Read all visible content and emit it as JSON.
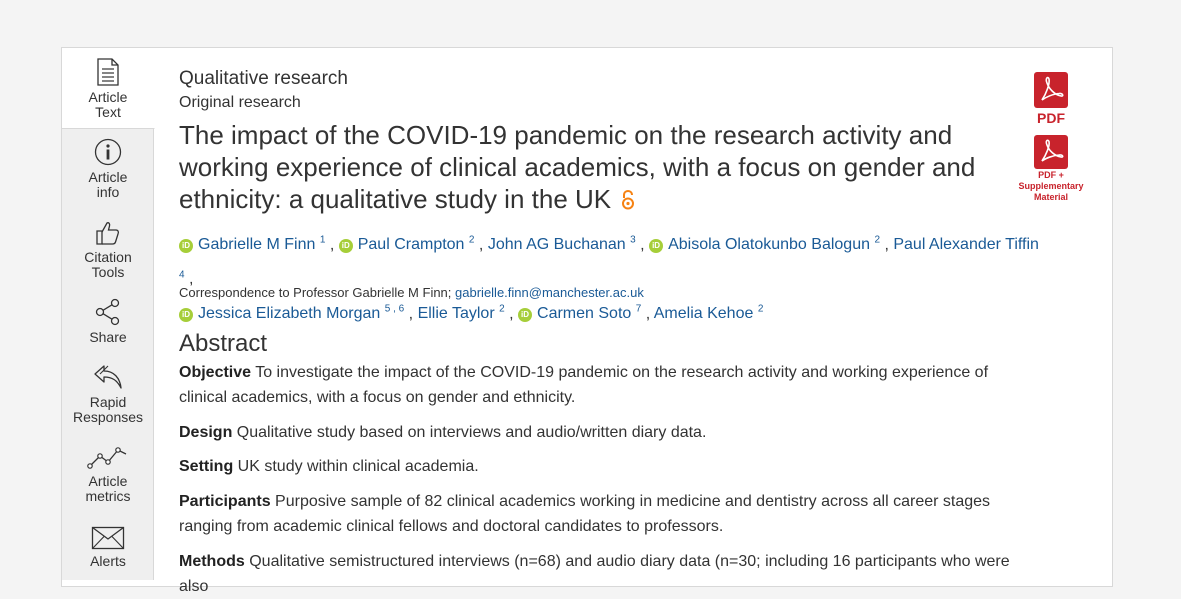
{
  "sidebar": {
    "items": [
      {
        "line1": "Article",
        "line2": "Text"
      },
      {
        "line1": "Article",
        "line2": "info"
      },
      {
        "line1": "Citation",
        "line2": "Tools"
      },
      {
        "line1": "Share",
        "line2": ""
      },
      {
        "line1": "Rapid",
        "line2": "Responses"
      },
      {
        "line1": "Article",
        "line2": "metrics"
      },
      {
        "line1": "Alerts",
        "line2": ""
      }
    ]
  },
  "article": {
    "section": "Qualitative research",
    "subsection": "Original research",
    "title": "The impact of the COVID-19 pandemic on the research activity and working experience of clinical academics, with a focus on gender and ethnicity: a qualitative study in the UK",
    "authors": [
      {
        "name": "Gabrielle M Finn",
        "aff": "1",
        "orcid": true
      },
      {
        "name": "Paul Crampton",
        "aff": "2",
        "orcid": true
      },
      {
        "name": "John AG Buchanan",
        "aff": "3",
        "orcid": false
      },
      {
        "name": "Abisola Olatokunbo Balogun",
        "aff": "2",
        "orcid": true
      },
      {
        "name": "Paul Alexander Tiffin",
        "aff": "4",
        "orcid": false
      },
      {
        "name": "Jessica Elizabeth Morgan",
        "aff": "5 , 6",
        "orcid": true
      },
      {
        "name": "Ellie Taylor",
        "aff": "2",
        "orcid": false
      },
      {
        "name": "Carmen Soto",
        "aff": "7",
        "orcid": true
      },
      {
        "name": "Amelia Kehoe",
        "aff": "2",
        "orcid": false
      }
    ],
    "orcid_badge": "iD",
    "correspondence_label": "Correspondence to Professor Gabrielle M Finn;",
    "correspondence_email": "gabrielle.finn@manchester.ac.uk"
  },
  "abstract": {
    "heading": "Abstract",
    "sections": [
      {
        "label": "Objective",
        "text": "To investigate the impact of the COVID-19 pandemic on the research activity and working experience of clinical academics, with a focus on gender and ethnicity."
      },
      {
        "label": "Design",
        "text": "Qualitative study based on interviews and audio/written diary data."
      },
      {
        "label": "Setting",
        "text": "UK study within clinical academia."
      },
      {
        "label": "Participants",
        "text": "Purposive sample of 82 clinical academics working in medicine and dentistry across all career stages ranging from academic clinical fellows and doctoral candidates to professors."
      },
      {
        "label": "Methods",
        "text": "Qualitative semistructured interviews (n=68) and audio diary data (n=30; including 16 participants who were also"
      }
    ]
  },
  "pdf": {
    "label": "PDF",
    "supp_line1": "PDF +",
    "supp_line2": "Supplementary",
    "supp_line3": "Material",
    "icon_color": "#c8232c"
  },
  "colors": {
    "link": "#1a5a96",
    "orcid": "#a6ce39",
    "open_access": "#f68212"
  }
}
